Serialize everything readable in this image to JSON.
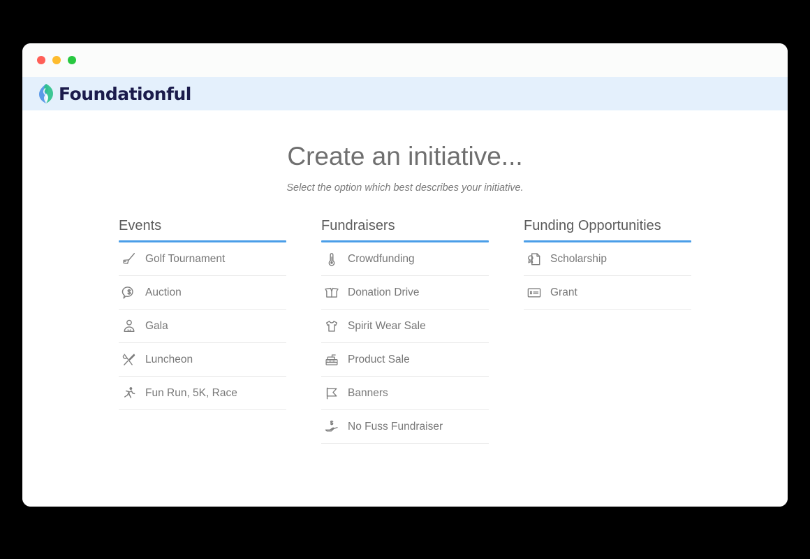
{
  "window": {
    "titlebar": {
      "buttons": [
        {
          "name": "close-button",
          "color": "#ff5f57"
        },
        {
          "name": "minimize-button",
          "color": "#febc2e"
        },
        {
          "name": "maximize-button",
          "color": "#28c840"
        }
      ]
    },
    "brandbar": {
      "logo_icon": "foundationful-leaf-icon",
      "brand_name": "Foundationful",
      "background": "#e4f0fc",
      "logo_colors": {
        "blue": "#5b9ae8",
        "green": "#2ec28b"
      },
      "wordmark_color": "#1b1b4b"
    }
  },
  "main": {
    "title": "Create an initiative...",
    "subtitle": "Select the option which best describes your initiative.",
    "accent_color": "#4a9ee8",
    "columns": [
      {
        "title": "Events",
        "options": [
          {
            "label": "Golf Tournament",
            "icon": "golf-club-icon"
          },
          {
            "label": "Auction",
            "icon": "dollar-speech-bubble-icon"
          },
          {
            "label": "Gala",
            "icon": "person-bowtie-icon"
          },
          {
            "label": "Luncheon",
            "icon": "crossed-utensils-icon"
          },
          {
            "label": "Fun Run, 5K, Race",
            "icon": "running-person-icon"
          }
        ]
      },
      {
        "title": "Fundraisers",
        "options": [
          {
            "label": "Crowdfunding",
            "icon": "thermometer-icon"
          },
          {
            "label": "Donation Drive",
            "icon": "open-box-icon"
          },
          {
            "label": "Spirit Wear Sale",
            "icon": "tshirt-icon"
          },
          {
            "label": "Product Sale",
            "icon": "cash-register-icon"
          },
          {
            "label": "Banners",
            "icon": "flag-icon"
          },
          {
            "label": "No Fuss Fundraiser",
            "icon": "hand-dollar-icon"
          }
        ]
      },
      {
        "title": "Funding Opportunities",
        "options": [
          {
            "label": "Scholarship",
            "icon": "award-document-icon"
          },
          {
            "label": "Grant",
            "icon": "check-card-icon"
          }
        ]
      }
    ]
  }
}
